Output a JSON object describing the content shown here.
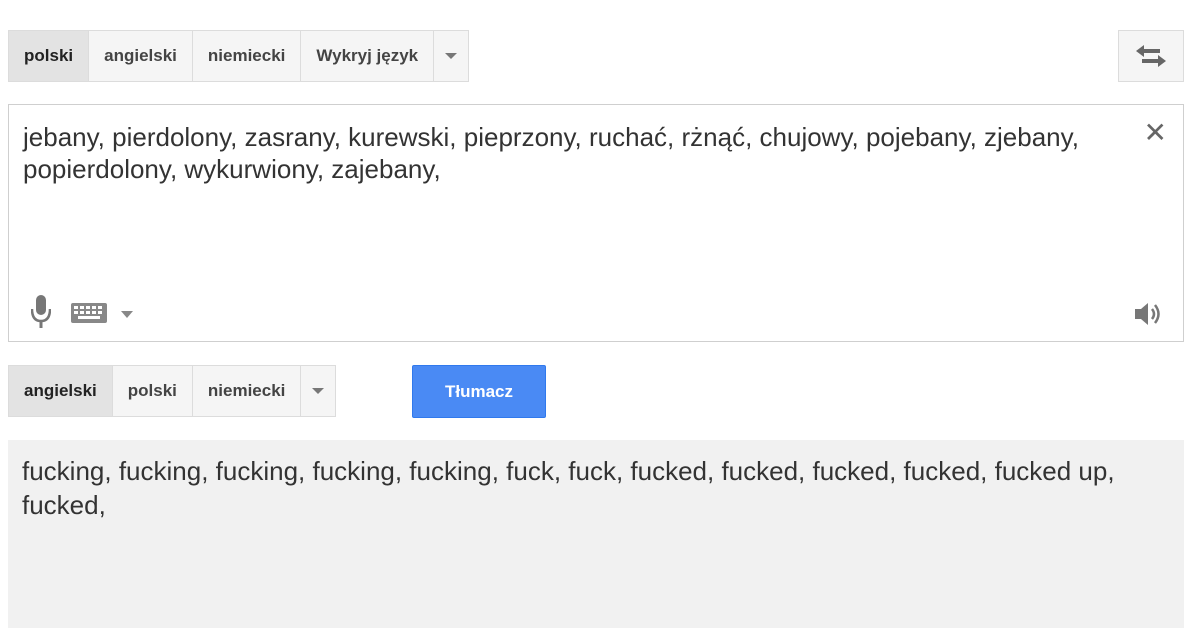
{
  "source_languages": {
    "items": [
      "polski",
      "angielski",
      "niemiecki",
      "Wykryj język"
    ],
    "active_index": 0
  },
  "target_languages": {
    "items": [
      "angielski",
      "polski",
      "niemiecki"
    ],
    "active_index": 0
  },
  "source": {
    "text": "jebany, pierdolony, zasrany, kurewski, pieprzony, ruchać, rżnąć, chujowy, pojebany, zjebany, popierdolony, wykurwiony, zajebany,"
  },
  "result": {
    "text": "fucking, fucking, fucking, fucking, fucking, fuck, fuck, fucked, fucked, fucked, fucked, fucked up, fucked,"
  },
  "translate_button": {
    "label": "Tłumacz"
  },
  "colors": {
    "accent": "#4a8af4",
    "result_bg": "#f1f1f1",
    "bar_bg": "#f5f5f5"
  },
  "icons": [
    "swap-icon",
    "clear-icon",
    "mic-icon",
    "keyboard-icon",
    "chevron-down-icon",
    "speaker-icon"
  ]
}
